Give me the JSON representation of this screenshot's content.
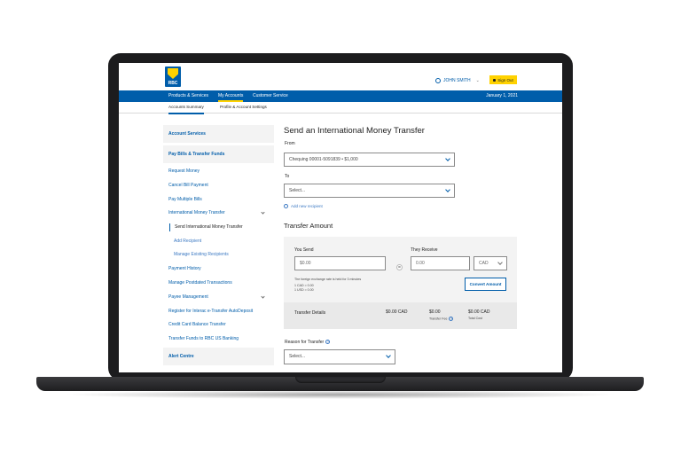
{
  "brand": {
    "logo_text": "RBC",
    "primary_color": "#005daa",
    "accent_color": "#ffd200"
  },
  "header": {
    "user_name": "JOHN SMITH",
    "user_icon": "person-icon",
    "sign_out_label": "Sign Out"
  },
  "nav": {
    "items": [
      {
        "label": "Products & Services"
      },
      {
        "label": "My Accounts"
      },
      {
        "label": "Customer Service"
      }
    ],
    "active": "My Accounts",
    "date": "January 1, 2021"
  },
  "subnav": {
    "items": [
      {
        "label": "Accounts Summary"
      },
      {
        "label": "Profile & Account Settings"
      }
    ],
    "active": "Accounts Summary"
  },
  "sidebar": {
    "account_services": "Account Services",
    "pay_bills": "Pay Bills & Transfer Funds",
    "links": [
      {
        "label": "Request Money"
      },
      {
        "label": "Cancel Bill Payment"
      },
      {
        "label": "Pay Multiple Bills"
      },
      {
        "label": "International Money Transfer"
      },
      {
        "label": "Send International Money Transfer"
      },
      {
        "label": "Add Recipient"
      },
      {
        "label": "Manage Existing Recipients"
      },
      {
        "label": "Payment History"
      },
      {
        "label": "Manage Postdated Transactions"
      },
      {
        "label": "Payee Management"
      },
      {
        "label": "Register for Interac e-Transfer AutoDeposit"
      },
      {
        "label": "Credit Card Balance Transfer"
      },
      {
        "label": "Transfer Funds to RBC US Banking"
      }
    ],
    "alert_centre": "Alert Centre"
  },
  "main": {
    "title": "Send an International Money Transfer",
    "from_label": "From",
    "from_value": "Chequing 00001-5091839 • $1,000",
    "to_label": "To",
    "to_placeholder": "Select...",
    "add_recipient": "Add new recipient",
    "transfer_amount_heading": "Transfer Amount",
    "you_send_label": "You Send",
    "you_send_value": "$0.00",
    "equals_symbol": "=",
    "they_receive_label": "They Receive",
    "they_receive_value": "0.00",
    "currency": "CAD",
    "rate_note": "The foreign exchange rate is held for 3 minutes",
    "rate_line1": "1 CAD = 0.00",
    "rate_line2": "1 USD = 0.00",
    "convert_button": "Convert Amount",
    "details": {
      "label": "Transfer Details",
      "amount": "$0.00 CAD",
      "fee": "$0.00",
      "fee_label": "Transfer Fee",
      "total": "$0.00 CAD",
      "total_label": "Total Cost"
    },
    "reason_label": "Reason for Transfer",
    "reason_placeholder": "Select..."
  }
}
